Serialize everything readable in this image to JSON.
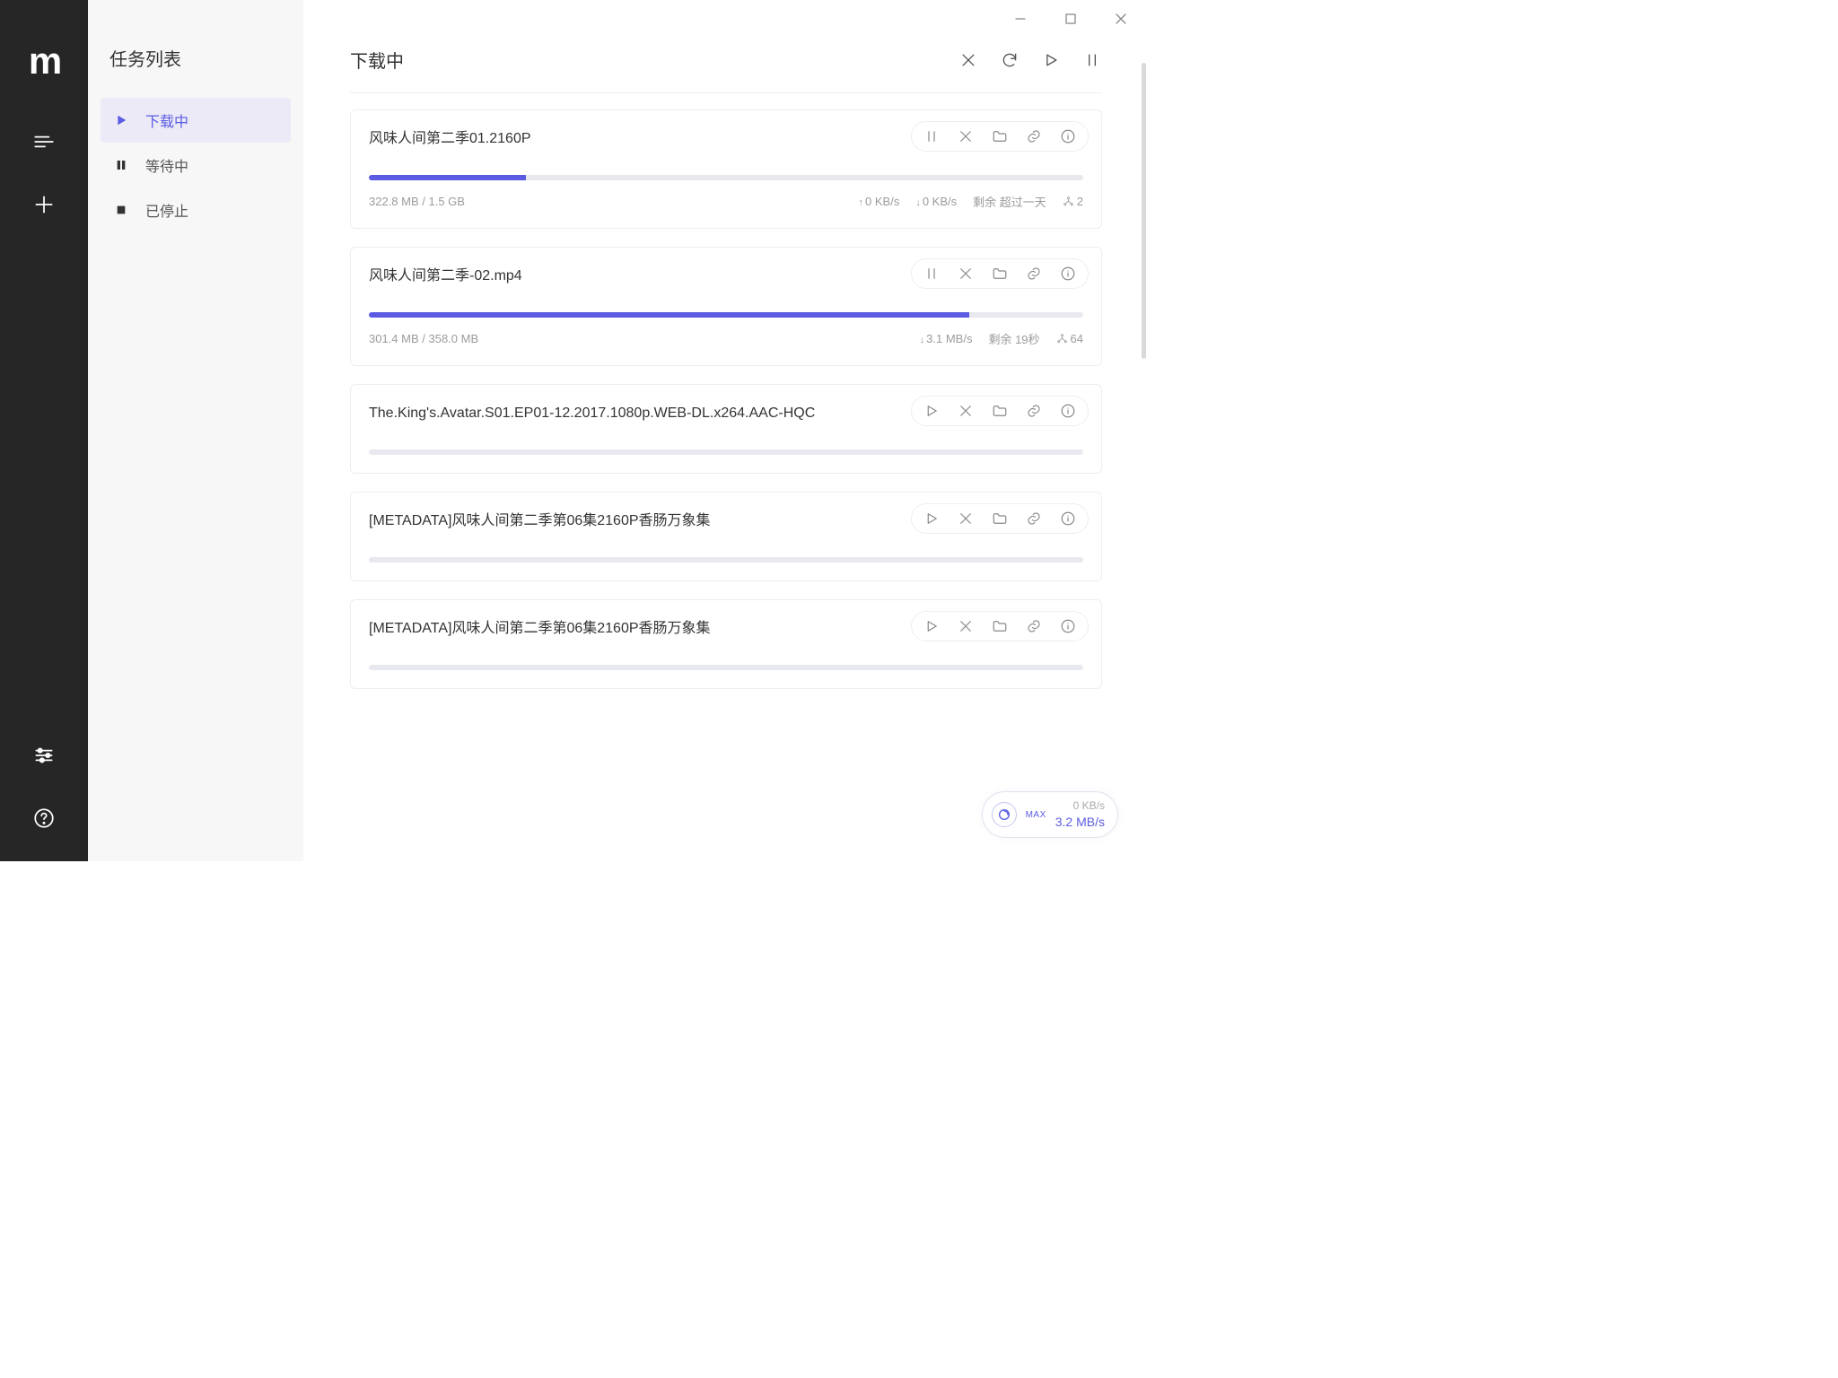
{
  "sidebar": {
    "title": "任务列表",
    "items": [
      {
        "label": "下载中"
      },
      {
        "label": "等待中"
      },
      {
        "label": "已停止"
      }
    ]
  },
  "header": {
    "title": "下载中"
  },
  "tasks": [
    {
      "name": "风味人间第二季01.2160P",
      "progress_pct": 22,
      "first_icon": "pause",
      "size": "322.8 MB / 1.5 GB",
      "up": "0 KB/s",
      "down": "0 KB/s",
      "remaining": "剩余 超过一天",
      "peers": "2",
      "show_up": true
    },
    {
      "name": "风味人间第二季-02.mp4",
      "progress_pct": 84,
      "first_icon": "pause",
      "size": "301.4 MB / 358.0 MB",
      "up": "",
      "down": "3.1 MB/s",
      "remaining": "剩余 19秒",
      "peers": "64",
      "show_up": false
    },
    {
      "name": "The.King's.Avatar.S01.EP01-12.2017.1080p.WEB-DL.x264.AAC-HQC",
      "progress_pct": 0,
      "first_icon": "play",
      "size": "",
      "up": "",
      "down": "",
      "remaining": "",
      "peers": "",
      "show_up": false
    },
    {
      "name": "[METADATA]风味人间第二季第06集2160P香肠万象集",
      "progress_pct": 0,
      "first_icon": "play",
      "size": "",
      "up": "",
      "down": "",
      "remaining": "",
      "peers": "",
      "show_up": false
    },
    {
      "name": "[METADATA]风味人间第二季第06集2160P香肠万象集",
      "progress_pct": 0,
      "first_icon": "play",
      "size": "",
      "up": "",
      "down": "",
      "remaining": "",
      "peers": "",
      "show_up": false
    }
  ],
  "bubble": {
    "max": "MAX",
    "up": "0 KB/s",
    "down": "3.2 MB/s"
  }
}
